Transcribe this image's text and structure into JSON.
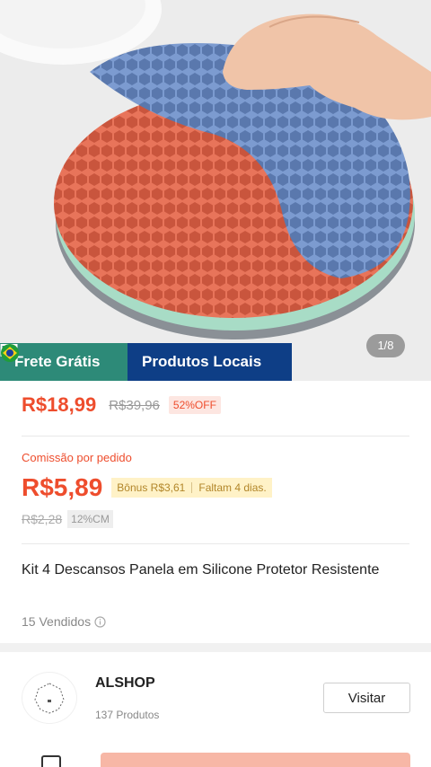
{
  "hero": {
    "image_counter": "1/8",
    "badges": [
      {
        "label": "Frete Grátis",
        "icon": "truck-icon",
        "color": "#2d8a78"
      },
      {
        "label": "Produtos Locais",
        "icon": "brazil-flag-icon",
        "color": "#0e3e86"
      }
    ]
  },
  "price": {
    "current": "R$18,99",
    "original": "R$39,96",
    "discount": "52%OFF"
  },
  "commission": {
    "label": "Comissão por pedido",
    "value": "R$5,89",
    "bonus": "Bônus R$3,61",
    "remaining": "Faltam 4 dias.",
    "old_value": "R$2,28",
    "rate": "12%CM"
  },
  "product": {
    "title": "Kit 4 Descansos Panela em Silicone Protetor Resistente",
    "sold": "15 Vendidos"
  },
  "shop": {
    "name": "ALSHOP",
    "products": "137 Produtos",
    "visit_label": "Visitar"
  },
  "colors": {
    "accent": "#ee4d2d",
    "mat_orange": "#e8745a",
    "mat_blue": "#6f8fc4",
    "mat_green": "#a8dcc6",
    "mat_gray": "#8a9096"
  }
}
